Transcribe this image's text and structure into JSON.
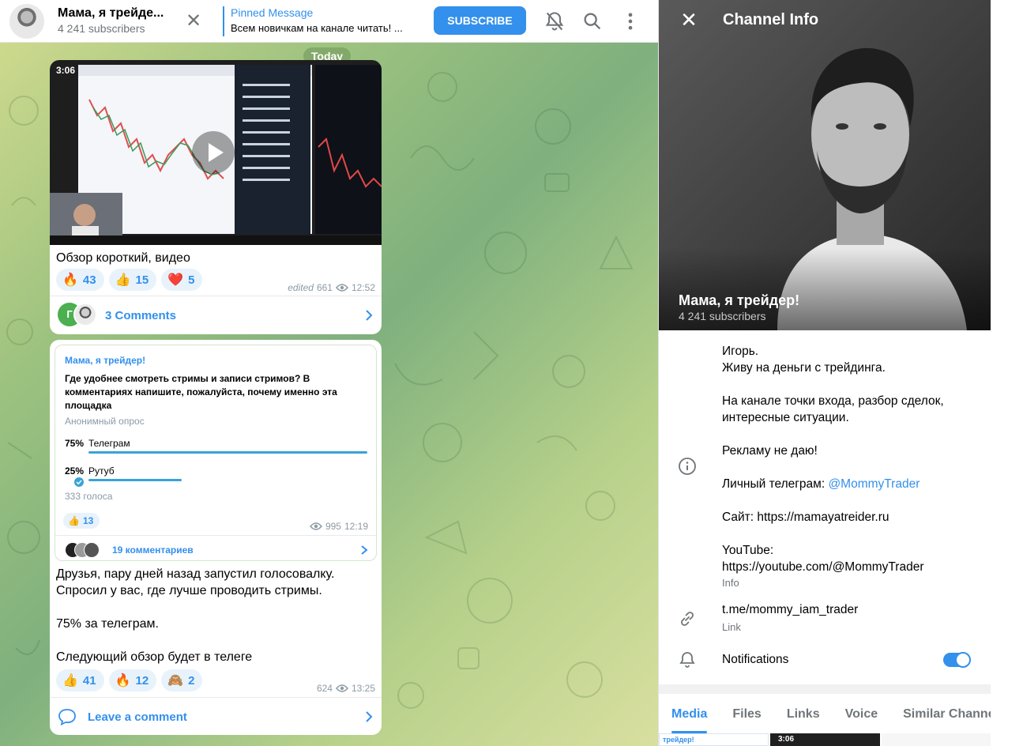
{
  "header": {
    "title": "Мама, я трейде...",
    "subscribers": "4 241 subscribers",
    "pinned_title": "Pinned Message",
    "pinned_text": "Всем новичкам на канале читать! ...",
    "subscribe_label": "SUBSCRIBE"
  },
  "date_badge": "Today",
  "message1": {
    "video_duration": "3:06",
    "text": "Обзор короткий, видео",
    "reactions": [
      {
        "emoji": "🔥",
        "count": "43"
      },
      {
        "emoji": "👍",
        "count": "15"
      },
      {
        "emoji": "❤️",
        "count": "5"
      }
    ],
    "edited": "edited",
    "views": "661",
    "time": "12:52",
    "comments_avatar_letter": "Г",
    "comments_label": "3 Comments"
  },
  "message2": {
    "poll": {
      "author": "Мама, я трейдер!",
      "question": "Где удобнее смотреть стримы и записи стримов? В комментариях напишите, пожалуйста, почему именно эта площадка",
      "type": "Анонимный опрос",
      "options": [
        {
          "percent": "75%",
          "label": "Телеграм",
          "fraction": 0.75
        },
        {
          "percent": "25%",
          "label": "Рутуб",
          "fraction": 0.25
        }
      ],
      "votes": "333 голоса",
      "reaction_emoji": "👍",
      "reaction_count": "13",
      "views": "995",
      "time": "12:19",
      "comments_label": "19 комментариев"
    },
    "text": "Друзья, пару дней назад запустил голосовалку.\nСпросил у вас, где лучше проводить стримы.\n\n75% за телеграм.\n\nСледующий обзор будет в телеге",
    "reactions": [
      {
        "emoji": "👍",
        "count": "41"
      },
      {
        "emoji": "🔥",
        "count": "12"
      },
      {
        "emoji": "🙈",
        "count": "2"
      }
    ],
    "views": "624",
    "time": "13:25",
    "comments_label": "Leave a comment"
  },
  "info_panel": {
    "title": "Channel Info",
    "name": "Мама, я трейдер!",
    "subscribers": "4 241 subscribers",
    "about": {
      "line1": "Игорь.",
      "line2": "Живу на деньги с трейдинга.",
      "line3": "На канале точки входа, разбор сделок,",
      "line4": "интересные ситуации.",
      "line5": "Рекламу не даю!",
      "line6_prefix": "Личный телеграм: ",
      "line6_link": "@MommyTrader",
      "line7": "Сайт: https://mamayatreider.ru",
      "line8": "YouTube:",
      "line9": "https://youtube.com/@MommyTrader"
    },
    "about_caption": "Info",
    "link_value": "t.me/mommy_iam_trader",
    "link_caption": "Link",
    "notifications_label": "Notifications",
    "notifications_on": true,
    "tabs": [
      "Media",
      "Files",
      "Links",
      "Voice",
      "Similar Channels"
    ],
    "media_thumb1_text": "трейдер!",
    "media_thumb2_text": "3:06"
  },
  "colors": {
    "accent": "#3390ec",
    "muted": "#707579",
    "reaction_bg": "#e8f2fb"
  }
}
